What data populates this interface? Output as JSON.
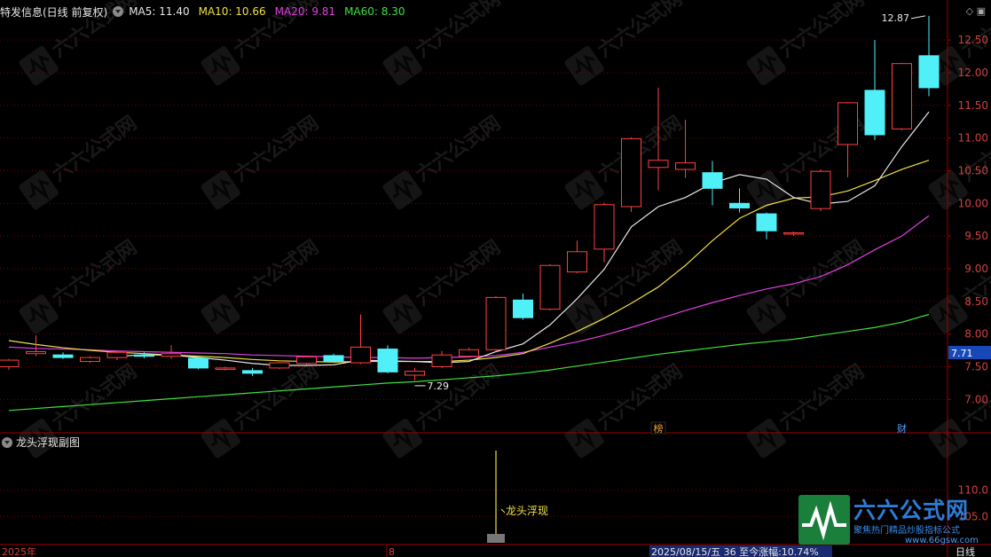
{
  "header": {
    "title": "特发信息(日线 前复权)",
    "ma_labels": [
      {
        "text": "MA5: 11.40",
        "color": "#e8e8e8"
      },
      {
        "text": "MA10: 10.66",
        "color": "#f0e040"
      },
      {
        "text": "MA20: 9.81",
        "color": "#e040e0"
      },
      {
        "text": "MA60: 8.30",
        "color": "#40e040"
      }
    ]
  },
  "sub_panel": {
    "title": "龙头浮现副图",
    "signal_label": "龙头浮现"
  },
  "markers": {
    "bang": "榜",
    "cai": "财"
  },
  "bottom": {
    "year_label": "2025年",
    "month_label": "8",
    "status": "2025/08/15/五 36 至今涨幅:10.74%",
    "period": "日线"
  },
  "logo": {
    "title": "六六公式网",
    "subtitle": "聚焦热门精品炒股指标公式",
    "url": "www.66gsw.com"
  },
  "colors": {
    "up": "#ff4040",
    "down": "#50f0f8",
    "ma5": "#e8e8e8",
    "ma10": "#f0e040",
    "ma20": "#e040e0",
    "ma60": "#40e040",
    "grid": "#8b0000",
    "last_price_bg": "#1848b8"
  },
  "chart_data": {
    "type": "candlestick",
    "ylim": [
      6.8,
      12.95
    ],
    "yticks": [
      "7.00",
      "7.50",
      "8.00",
      "8.50",
      "9.00",
      "9.50",
      "10.00",
      "10.50",
      "11.00",
      "11.50",
      "12.00",
      "12.50"
    ],
    "last_price": "7.71",
    "annotations": {
      "high": "12.87",
      "low": "7.29"
    },
    "candles": [
      {
        "o": 7.5,
        "h": 7.62,
        "l": 7.45,
        "c": 7.6
      },
      {
        "o": 7.7,
        "h": 7.98,
        "l": 7.66,
        "c": 7.73
      },
      {
        "o": 7.68,
        "h": 7.72,
        "l": 7.62,
        "c": 7.64
      },
      {
        "o": 7.58,
        "h": 7.66,
        "l": 7.56,
        "c": 7.64
      },
      {
        "o": 7.64,
        "h": 7.75,
        "l": 7.6,
        "c": 7.72
      },
      {
        "o": 7.68,
        "h": 7.72,
        "l": 7.63,
        "c": 7.66
      },
      {
        "o": 7.66,
        "h": 7.83,
        "l": 7.62,
        "c": 7.7
      },
      {
        "o": 7.63,
        "h": 7.64,
        "l": 7.46,
        "c": 7.48
      },
      {
        "o": 7.46,
        "h": 7.5,
        "l": 7.44,
        "c": 7.48
      },
      {
        "o": 7.44,
        "h": 7.48,
        "l": 7.36,
        "c": 7.4
      },
      {
        "o": 7.48,
        "h": 7.57,
        "l": 7.46,
        "c": 7.56
      },
      {
        "o": 7.55,
        "h": 7.66,
        "l": 7.53,
        "c": 7.65
      },
      {
        "o": 7.67,
        "h": 7.7,
        "l": 7.56,
        "c": 7.58
      },
      {
        "o": 7.56,
        "h": 8.3,
        "l": 7.54,
        "c": 7.8
      },
      {
        "o": 7.77,
        "h": 7.83,
        "l": 7.4,
        "c": 7.42
      },
      {
        "o": 7.37,
        "h": 7.48,
        "l": 7.29,
        "c": 7.43
      },
      {
        "o": 7.5,
        "h": 7.74,
        "l": 7.48,
        "c": 7.68
      },
      {
        "o": 7.66,
        "h": 7.79,
        "l": 7.64,
        "c": 7.76
      },
      {
        "o": 7.76,
        "h": 8.58,
        "l": 7.74,
        "c": 8.56
      },
      {
        "o": 8.52,
        "h": 8.62,
        "l": 8.22,
        "c": 8.25
      },
      {
        "o": 8.38,
        "h": 9.07,
        "l": 8.36,
        "c": 9.05
      },
      {
        "o": 8.95,
        "h": 9.43,
        "l": 8.93,
        "c": 9.26
      },
      {
        "o": 9.3,
        "h": 10.01,
        "l": 9.1,
        "c": 9.98
      },
      {
        "o": 9.95,
        "h": 11.01,
        "l": 9.87,
        "c": 10.99
      },
      {
        "o": 10.55,
        "h": 11.77,
        "l": 10.2,
        "c": 10.66
      },
      {
        "o": 10.52,
        "h": 11.28,
        "l": 10.39,
        "c": 10.62
      },
      {
        "o": 10.47,
        "h": 10.65,
        "l": 9.97,
        "c": 10.23
      },
      {
        "o": 10.0,
        "h": 10.23,
        "l": 9.86,
        "c": 9.93
      },
      {
        "o": 9.84,
        "h": 9.86,
        "l": 9.45,
        "c": 9.58
      },
      {
        "o": 9.53,
        "h": 9.57,
        "l": 9.5,
        "c": 9.55
      },
      {
        "o": 9.92,
        "h": 10.52,
        "l": 9.88,
        "c": 10.49
      },
      {
        "o": 10.9,
        "h": 11.55,
        "l": 10.4,
        "c": 11.54
      },
      {
        "o": 11.73,
        "h": 12.5,
        "l": 10.97,
        "c": 11.05
      },
      {
        "o": 11.14,
        "h": 12.15,
        "l": 11.12,
        "c": 12.14
      },
      {
        "o": 12.26,
        "h": 12.87,
        "l": 11.64,
        "c": 11.77
      }
    ],
    "ma5": [
      null,
      null,
      null,
      null,
      7.66,
      7.68,
      7.68,
      7.64,
      7.6,
      7.55,
      7.52,
      7.52,
      7.53,
      7.6,
      7.59,
      7.58,
      7.56,
      7.58,
      7.73,
      7.85,
      8.14,
      8.54,
      8.99,
      9.64,
      9.95,
      10.09,
      10.31,
      10.44,
      10.37,
      10.09,
      9.99,
      10.03,
      10.27,
      10.87,
      11.4
    ],
    "ma10": [
      7.9,
      7.84,
      7.79,
      7.75,
      7.72,
      7.7,
      7.68,
      7.66,
      7.64,
      7.61,
      7.59,
      7.58,
      7.57,
      7.58,
      7.58,
      7.58,
      7.58,
      7.6,
      7.64,
      7.7,
      7.86,
      8.04,
      8.24,
      8.47,
      8.72,
      9.05,
      9.43,
      9.77,
      9.97,
      10.08,
      10.1,
      10.19,
      10.35,
      10.52,
      10.66
    ],
    "ma20": [
      7.8,
      7.78,
      7.77,
      7.76,
      7.74,
      7.73,
      7.72,
      7.71,
      7.7,
      7.68,
      7.67,
      7.66,
      7.65,
      7.64,
      7.64,
      7.63,
      7.64,
      7.65,
      7.67,
      7.72,
      7.8,
      7.88,
      7.98,
      8.1,
      8.23,
      8.36,
      8.48,
      8.59,
      8.69,
      8.77,
      8.88,
      9.06,
      9.29,
      9.5,
      9.81
    ],
    "ma60": [
      6.83,
      6.86,
      6.89,
      6.92,
      6.95,
      6.98,
      7.01,
      7.04,
      7.07,
      7.1,
      7.13,
      7.16,
      7.19,
      7.22,
      7.25,
      7.27,
      7.3,
      7.33,
      7.36,
      7.4,
      7.45,
      7.51,
      7.57,
      7.63,
      7.69,
      7.74,
      7.79,
      7.84,
      7.88,
      7.92,
      7.98,
      8.04,
      8.1,
      8.18,
      8.3
    ],
    "sub": {
      "ylim": [
        100,
        118
      ],
      "yticks": [
        "110.0",
        "105.0"
      ],
      "signal_index": 18
    }
  }
}
